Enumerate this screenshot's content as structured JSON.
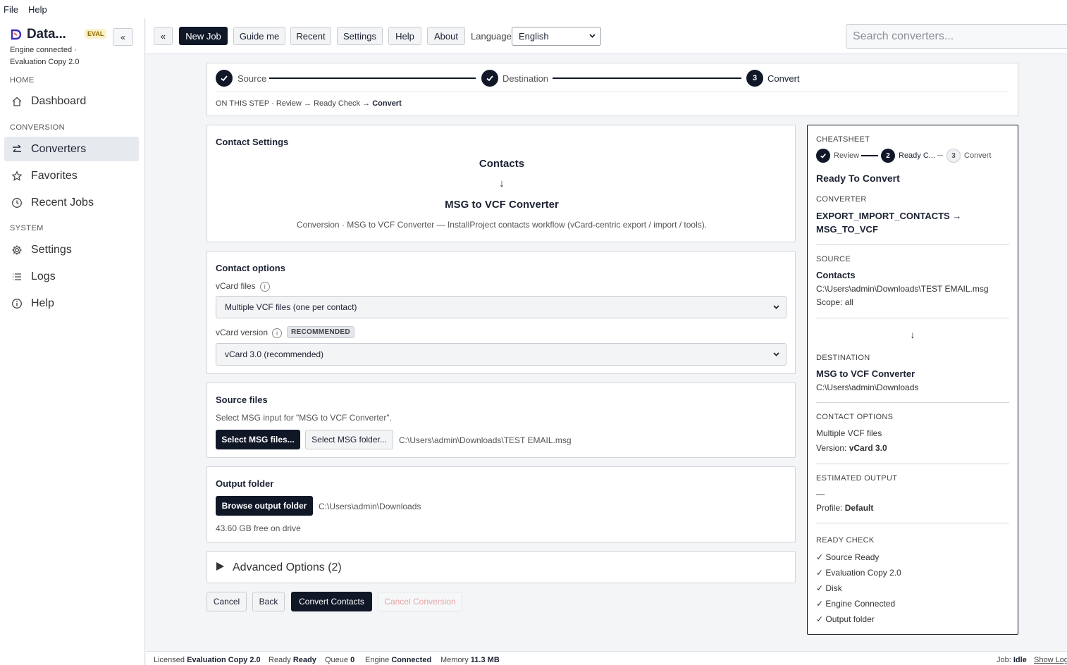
{
  "menubar": {
    "file": "File",
    "help": "Help"
  },
  "sidebar": {
    "brand_name": "Data...",
    "eval_badge": "EVAL",
    "collapse_label": "«",
    "engine_status": "Engine connected ·",
    "edition": "Evaluation Copy 2.0",
    "sections": {
      "home": "HOME",
      "conversion": "CONVERSION",
      "system": "SYSTEM"
    },
    "items": {
      "dashboard": "Dashboard",
      "converters": "Converters",
      "favorites": "Favorites",
      "recent_jobs": "Recent Jobs",
      "settings": "Settings",
      "logs": "Logs",
      "help": "Help"
    }
  },
  "toolbar": {
    "collapse": "«",
    "new_job": "New Job",
    "guide_me": "Guide me",
    "recent": "Recent",
    "settings": "Settings",
    "help": "Help",
    "about": "About",
    "language_label": "Language",
    "language_value": "English",
    "search_placeholder": "Search converters..."
  },
  "stepper": {
    "steps": [
      {
        "label": "Source",
        "state": "done"
      },
      {
        "label": "Destination",
        "state": "done"
      },
      {
        "label": "Convert",
        "number": "3",
        "state": "current"
      }
    ],
    "on_this_step_label": "ON THIS STEP",
    "sub_steps": [
      "Review",
      "Ready Check",
      "Convert"
    ]
  },
  "contact_settings": {
    "title": "Contact Settings",
    "source": "Contacts",
    "arrow": "↓",
    "target": "MSG to VCF Converter",
    "description": "Conversion · MSG to VCF Converter — InstallProject contacts workflow (vCard-centric export / import / tools)."
  },
  "contact_options": {
    "title": "Contact options",
    "vcard_files_label": "vCard files",
    "vcard_files_value": "Multiple VCF files (one per contact)",
    "vcard_version_label": "vCard version",
    "recommended_badge": "RECOMMENDED",
    "vcard_version_value": "vCard 3.0 (recommended)"
  },
  "source_files": {
    "title": "Source files",
    "hint": "Select MSG input for \"MSG to VCF Converter\".",
    "select_files": "Select MSG files...",
    "select_folder": "Select MSG folder...",
    "path": "C:\\Users\\admin\\Downloads\\TEST EMAIL.msg"
  },
  "output_folder": {
    "title": "Output folder",
    "browse": "Browse output folder",
    "path": "C:\\Users\\admin\\Downloads",
    "free_space": "43.60 GB free on drive"
  },
  "advanced": {
    "label": "Advanced Options (2)"
  },
  "actions": {
    "cancel": "Cancel",
    "back": "Back",
    "convert": "Convert Contacts",
    "cancel_conversion": "Cancel Conversion"
  },
  "cheatsheet": {
    "title": "CHEATSHEET",
    "mini_steps": [
      {
        "label": "Review",
        "state": "done"
      },
      {
        "label": "Ready C...",
        "number": "2",
        "state": "current"
      },
      {
        "label": "Convert",
        "number": "3",
        "state": "pending"
      }
    ],
    "heading": "Ready To Convert",
    "converter_label": "CONVERTER",
    "converter_value": "EXPORT_IMPORT_CONTACTS →",
    "converter_value2": "MSG_TO_VCF",
    "source_label": "SOURCE",
    "source_name": "Contacts",
    "source_path": "C:\\Users\\admin\\Downloads\\TEST EMAIL.msg",
    "source_scope": "Scope: all",
    "arrow": "↓",
    "destination_label": "DESTINATION",
    "destination_name": "MSG to VCF Converter",
    "destination_path": "C:\\Users\\admin\\Downloads",
    "contact_options_label": "CONTACT OPTIONS",
    "contact_options_files": "Multiple VCF files",
    "version_label": "Version:",
    "version_value": "vCard 3.0",
    "estimated_output_label": "ESTIMATED OUTPUT",
    "estimated_output_value": "—",
    "profile_label": "Profile:",
    "profile_value": "Default",
    "ready_check_label": "READY CHECK",
    "ready_checks": [
      "✓ Source Ready",
      "✓ Evaluation Copy 2.0",
      "✓ Disk",
      "✓ Engine Connected",
      "✓ Output folder"
    ]
  },
  "statusbar": {
    "licensed_label": "Licensed",
    "licensed_value": "Evaluation Copy 2.0",
    "ready_label": "Ready",
    "ready_value": "Ready",
    "queue_label": "Queue",
    "queue_value": "0",
    "engine_label": "Engine",
    "engine_value": "Connected",
    "memory_label": "Memory",
    "memory_value": "11.3 MB",
    "job_label": "Job:",
    "job_value": "Idle",
    "show_log": "Show Log"
  },
  "colors": {
    "primary": "#101828",
    "accent_logo": "#3b2bb8",
    "eval_badge_bg": "#fdf1c9"
  }
}
